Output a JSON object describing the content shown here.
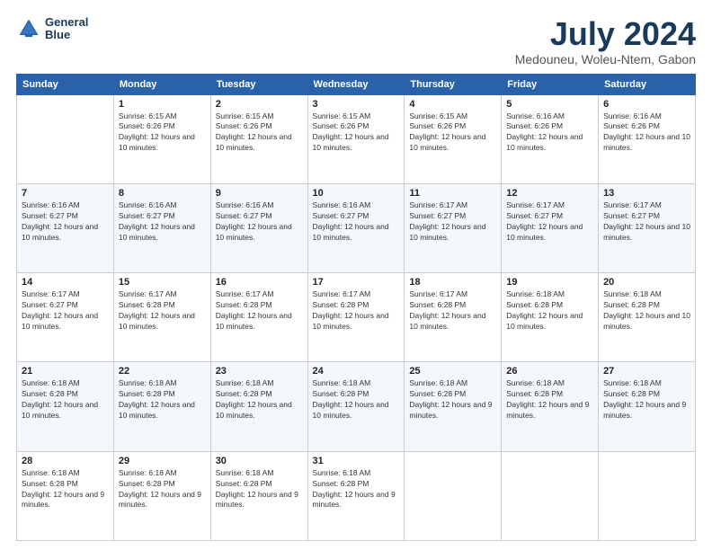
{
  "logo": {
    "line1": "General",
    "line2": "Blue"
  },
  "title": "July 2024",
  "subtitle": "Medouneu, Woleu-Ntem, Gabon",
  "weekdays": [
    "Sunday",
    "Monday",
    "Tuesday",
    "Wednesday",
    "Thursday",
    "Friday",
    "Saturday"
  ],
  "weeks": [
    [
      {
        "day": "",
        "info": ""
      },
      {
        "day": "1",
        "info": "Sunrise: 6:15 AM\nSunset: 6:26 PM\nDaylight: 12 hours and 10 minutes."
      },
      {
        "day": "2",
        "info": "Sunrise: 6:15 AM\nSunset: 6:26 PM\nDaylight: 12 hours and 10 minutes."
      },
      {
        "day": "3",
        "info": "Sunrise: 6:15 AM\nSunset: 6:26 PM\nDaylight: 12 hours and 10 minutes."
      },
      {
        "day": "4",
        "info": "Sunrise: 6:15 AM\nSunset: 6:26 PM\nDaylight: 12 hours and 10 minutes."
      },
      {
        "day": "5",
        "info": "Sunrise: 6:16 AM\nSunset: 6:26 PM\nDaylight: 12 hours and 10 minutes."
      },
      {
        "day": "6",
        "info": "Sunrise: 6:16 AM\nSunset: 6:26 PM\nDaylight: 12 hours and 10 minutes."
      }
    ],
    [
      {
        "day": "7",
        "info": "Sunrise: 6:16 AM\nSunset: 6:27 PM\nDaylight: 12 hours and 10 minutes."
      },
      {
        "day": "8",
        "info": "Sunrise: 6:16 AM\nSunset: 6:27 PM\nDaylight: 12 hours and 10 minutes."
      },
      {
        "day": "9",
        "info": "Sunrise: 6:16 AM\nSunset: 6:27 PM\nDaylight: 12 hours and 10 minutes."
      },
      {
        "day": "10",
        "info": "Sunrise: 6:16 AM\nSunset: 6:27 PM\nDaylight: 12 hours and 10 minutes."
      },
      {
        "day": "11",
        "info": "Sunrise: 6:17 AM\nSunset: 6:27 PM\nDaylight: 12 hours and 10 minutes."
      },
      {
        "day": "12",
        "info": "Sunrise: 6:17 AM\nSunset: 6:27 PM\nDaylight: 12 hours and 10 minutes."
      },
      {
        "day": "13",
        "info": "Sunrise: 6:17 AM\nSunset: 6:27 PM\nDaylight: 12 hours and 10 minutes."
      }
    ],
    [
      {
        "day": "14",
        "info": "Sunrise: 6:17 AM\nSunset: 6:27 PM\nDaylight: 12 hours and 10 minutes."
      },
      {
        "day": "15",
        "info": "Sunrise: 6:17 AM\nSunset: 6:28 PM\nDaylight: 12 hours and 10 minutes."
      },
      {
        "day": "16",
        "info": "Sunrise: 6:17 AM\nSunset: 6:28 PM\nDaylight: 12 hours and 10 minutes."
      },
      {
        "day": "17",
        "info": "Sunrise: 6:17 AM\nSunset: 6:28 PM\nDaylight: 12 hours and 10 minutes."
      },
      {
        "day": "18",
        "info": "Sunrise: 6:17 AM\nSunset: 6:28 PM\nDaylight: 12 hours and 10 minutes."
      },
      {
        "day": "19",
        "info": "Sunrise: 6:18 AM\nSunset: 6:28 PM\nDaylight: 12 hours and 10 minutes."
      },
      {
        "day": "20",
        "info": "Sunrise: 6:18 AM\nSunset: 6:28 PM\nDaylight: 12 hours and 10 minutes."
      }
    ],
    [
      {
        "day": "21",
        "info": "Sunrise: 6:18 AM\nSunset: 6:28 PM\nDaylight: 12 hours and 10 minutes."
      },
      {
        "day": "22",
        "info": "Sunrise: 6:18 AM\nSunset: 6:28 PM\nDaylight: 12 hours and 10 minutes."
      },
      {
        "day": "23",
        "info": "Sunrise: 6:18 AM\nSunset: 6:28 PM\nDaylight: 12 hours and 10 minutes."
      },
      {
        "day": "24",
        "info": "Sunrise: 6:18 AM\nSunset: 6:28 PM\nDaylight: 12 hours and 10 minutes."
      },
      {
        "day": "25",
        "info": "Sunrise: 6:18 AM\nSunset: 6:28 PM\nDaylight: 12 hours and 9 minutes."
      },
      {
        "day": "26",
        "info": "Sunrise: 6:18 AM\nSunset: 6:28 PM\nDaylight: 12 hours and 9 minutes."
      },
      {
        "day": "27",
        "info": "Sunrise: 6:18 AM\nSunset: 6:28 PM\nDaylight: 12 hours and 9 minutes."
      }
    ],
    [
      {
        "day": "28",
        "info": "Sunrise: 6:18 AM\nSunset: 6:28 PM\nDaylight: 12 hours and 9 minutes."
      },
      {
        "day": "29",
        "info": "Sunrise: 6:18 AM\nSunset: 6:28 PM\nDaylight: 12 hours and 9 minutes."
      },
      {
        "day": "30",
        "info": "Sunrise: 6:18 AM\nSunset: 6:28 PM\nDaylight: 12 hours and 9 minutes."
      },
      {
        "day": "31",
        "info": "Sunrise: 6:18 AM\nSunset: 6:28 PM\nDaylight: 12 hours and 9 minutes."
      },
      {
        "day": "",
        "info": ""
      },
      {
        "day": "",
        "info": ""
      },
      {
        "day": "",
        "info": ""
      }
    ]
  ]
}
